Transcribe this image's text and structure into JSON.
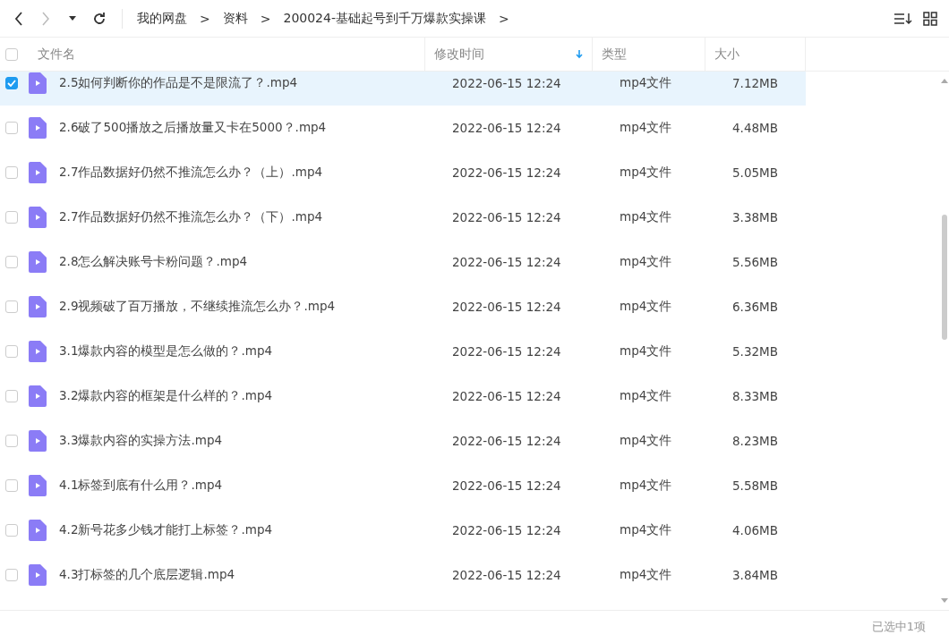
{
  "breadcrumb": [
    "我的网盘",
    "资料",
    "200024-基础起号到千万爆款实操课"
  ],
  "breadcrumb_separator": ">",
  "table": {
    "select_all": {
      "checked": false
    },
    "columns": [
      {
        "label": "文件名",
        "sorted": false
      },
      {
        "label": "修改时间",
        "sorted": true
      },
      {
        "label": "类型",
        "sorted": false
      },
      {
        "label": "大小",
        "sorted": false
      }
    ],
    "rows": [
      {
        "name": "2.5如何判断你的作品是不是限流了？.mp4",
        "modified": "2022-06-15 12:24",
        "type": "mp4文件",
        "size": "7.12MB",
        "selected": true
      },
      {
        "name": "2.6破了500播放之后播放量又卡在5000？.mp4",
        "modified": "2022-06-15 12:24",
        "type": "mp4文件",
        "size": "4.48MB",
        "selected": false
      },
      {
        "name": "2.7作品数据好仍然不推流怎么办？（上）.mp4",
        "modified": "2022-06-15 12:24",
        "type": "mp4文件",
        "size": "5.05MB",
        "selected": false
      },
      {
        "name": "2.7作品数据好仍然不推流怎么办？（下）.mp4",
        "modified": "2022-06-15 12:24",
        "type": "mp4文件",
        "size": "3.38MB",
        "selected": false
      },
      {
        "name": "2.8怎么解决账号卡粉问题？.mp4",
        "modified": "2022-06-15 12:24",
        "type": "mp4文件",
        "size": "5.56MB",
        "selected": false
      },
      {
        "name": "2.9视频破了百万播放，不继续推流怎么办？.mp4",
        "modified": "2022-06-15 12:24",
        "type": "mp4文件",
        "size": "6.36MB",
        "selected": false
      },
      {
        "name": "3.1爆款内容的模型是怎么做的？.mp4",
        "modified": "2022-06-15 12:24",
        "type": "mp4文件",
        "size": "5.32MB",
        "selected": false
      },
      {
        "name": "3.2爆款内容的框架是什么样的？.mp4",
        "modified": "2022-06-15 12:24",
        "type": "mp4文件",
        "size": "8.33MB",
        "selected": false
      },
      {
        "name": "3.3爆款内容的实操方法.mp4",
        "modified": "2022-06-15 12:24",
        "type": "mp4文件",
        "size": "8.23MB",
        "selected": false
      },
      {
        "name": "4.1标签到底有什么用？.mp4",
        "modified": "2022-06-15 12:24",
        "type": "mp4文件",
        "size": "5.58MB",
        "selected": false
      },
      {
        "name": "4.2新号花多少钱才能打上标签？.mp4",
        "modified": "2022-06-15 12:24",
        "type": "mp4文件",
        "size": "4.06MB",
        "selected": false
      },
      {
        "name": "4.3打标签的几个底层逻辑.mp4",
        "modified": "2022-06-15 12:24",
        "type": "mp4文件",
        "size": "3.84MB",
        "selected": false
      }
    ]
  },
  "status_bar": "已选中1项"
}
